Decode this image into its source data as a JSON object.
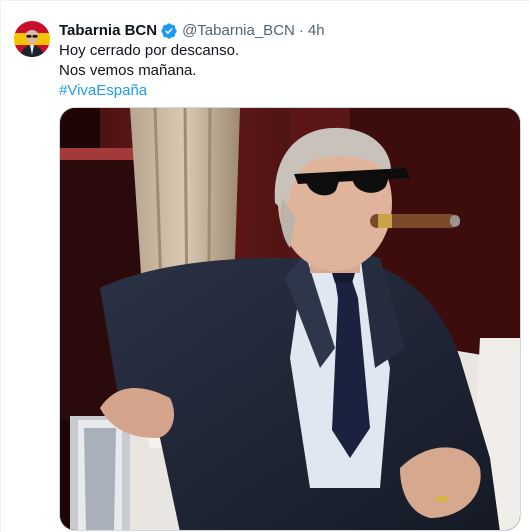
{
  "tweet": {
    "display_name": "Tabarnia BCN",
    "handle": "@Tabarnia_BCN",
    "separator": "·",
    "time": "4h",
    "lines": [
      "Hoy cerrado por descanso.",
      "Nos vemos mañana."
    ],
    "hashtag": "#VivaEspaña"
  },
  "icons": {
    "avatar": "profile-avatar",
    "verified": "verified-badge-icon"
  },
  "colors": {
    "text": "#0f1419",
    "secondary": "#536471",
    "accent": "#1d9bf0"
  }
}
